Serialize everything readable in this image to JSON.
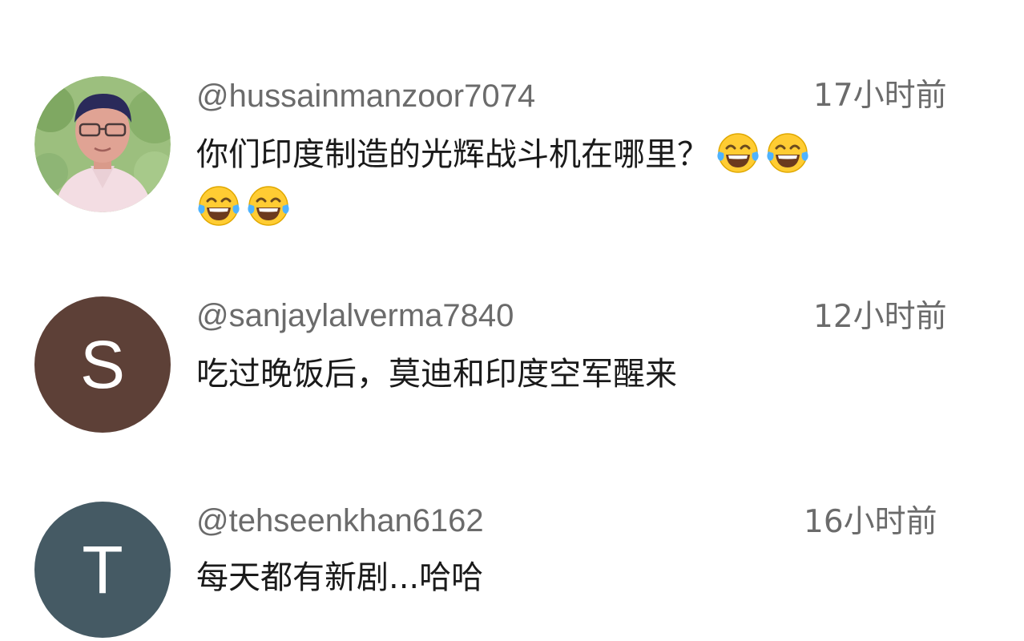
{
  "comments": [
    {
      "username": "@hussainmanzoor7074",
      "time": "17小时前",
      "text_line1": "你们印度制造的光辉战斗机在哪里？",
      "avatar_type": "photo",
      "emoji": "face-with-tears-of-joy-icon"
    },
    {
      "username": "@sanjaylalverma7840",
      "time": "12小时前",
      "text": "吃过晚饭后，莫迪和印度空军醒来",
      "avatar_letter": "S",
      "avatar_color": "#5d4037"
    },
    {
      "username": "@tehseenkhan6162",
      "time": "16小时前",
      "text": "每天都有新剧...哈哈",
      "avatar_letter": "T",
      "avatar_color": "#455a64"
    }
  ],
  "colors": {
    "meta_text": "#6b6b6b",
    "body_text": "#1a1a1a",
    "background": "#ffffff"
  }
}
